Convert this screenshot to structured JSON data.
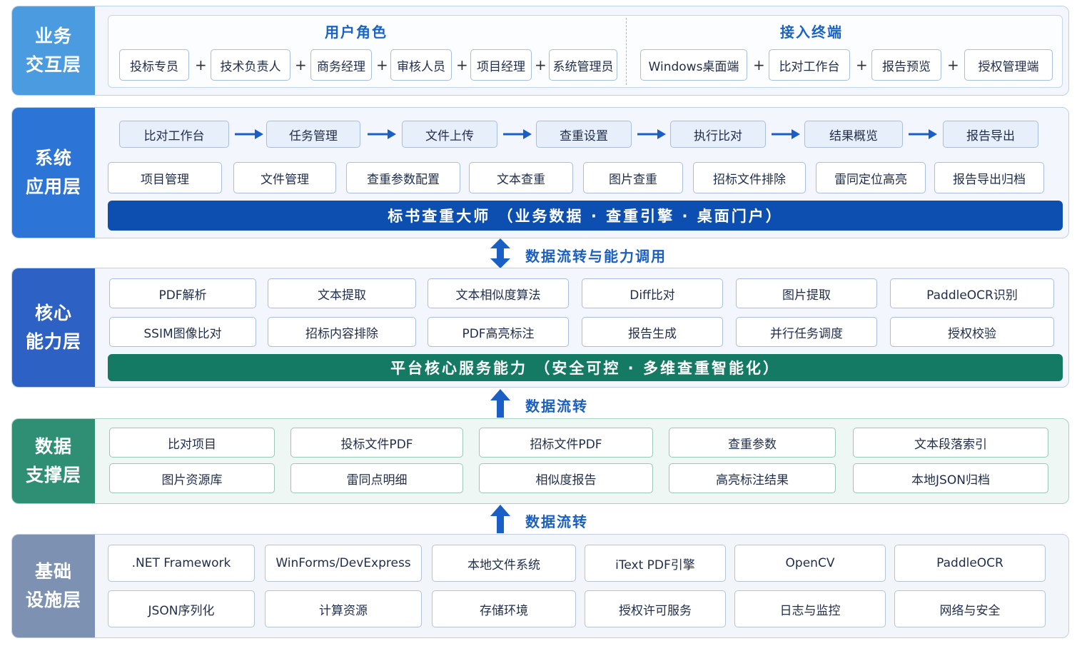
{
  "colors": {
    "business_label": "#4b9be0",
    "app_label": "#2c74d6",
    "core_label": "#2e61c4",
    "data_label": "#2f8f74",
    "infra_label": "#7d92b2",
    "app_banner": "#0d4fb0",
    "core_banner": "#157a63",
    "arrow": "#1a5fc3"
  },
  "layers": {
    "business": {
      "label": "业务\n交互层",
      "user_roles": {
        "title": "用户角色",
        "items": [
          "投标专员",
          "技术负责人",
          "商务经理",
          "审核人员",
          "项目经理",
          "系统管理员"
        ]
      },
      "terminals": {
        "title": "接入终端",
        "items": [
          "Windows桌面端",
          "比对工作台",
          "报告预览",
          "授权管理端"
        ]
      },
      "plus": "+"
    },
    "application": {
      "label": "系统\n应用层",
      "flow": [
        "比对工作台",
        "任务管理",
        "文件上传",
        "查重设置",
        "执行比对",
        "结果概览",
        "报告导出"
      ],
      "modules": [
        "项目管理",
        "文件管理",
        "查重参数配置",
        "文本查重",
        "图片查重",
        "招标文件排除",
        "雷同定位高亮",
        "报告导出归档"
      ],
      "banner": "标书查重大师 （业务数据 · 查重引擎 · 桌面门户）"
    },
    "core": {
      "label": "核心\n能力层",
      "row1": [
        "PDF解析",
        "文本提取",
        "文本相似度算法",
        "Diff比对",
        "图片提取",
        "PaddleOCR识别"
      ],
      "row2": [
        "SSIM图像比对",
        "招标内容排除",
        "PDF高亮标注",
        "报告生成",
        "并行任务调度",
        "授权校验"
      ],
      "banner": "平台核心服务能力 （安全可控 · 多维查重智能化）"
    },
    "data": {
      "label": "数据\n支撑层",
      "row1": [
        "比对项目",
        "投标文件PDF",
        "招标文件PDF",
        "查重参数",
        "文本段落索引"
      ],
      "row2": [
        "图片资源库",
        "雷同点明细",
        "相似度报告",
        "高亮标注结果",
        "本地JSON归档"
      ]
    },
    "infra": {
      "label": "基础\n设施层",
      "row1": [
        ".NET Framework",
        "WinForms/DevExpress",
        "本地文件系统",
        "iText PDF引擎",
        "OpenCV",
        "PaddleOCR"
      ],
      "row2": [
        "JSON序列化",
        "计算资源",
        "存储环境",
        "授权许可服务",
        "日志与监控",
        "网络与安全"
      ]
    }
  },
  "arrows": {
    "app_core": "数据流转与能力调用",
    "core_data": "数据流转",
    "data_infra": "数据流转"
  }
}
